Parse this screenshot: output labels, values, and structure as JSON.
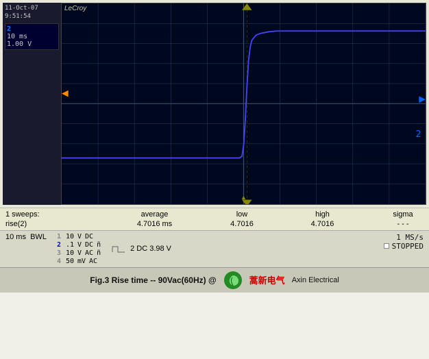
{
  "header": {
    "date": "11-Oct-07",
    "time": "9:51:54",
    "brand": "LeCroy"
  },
  "channel1": {
    "label": "2",
    "timebase": "10 ms",
    "voltage": "1.00 V"
  },
  "measurements": {
    "sweeps": "1 sweeps:",
    "cols": [
      "average",
      "low",
      "high",
      "sigma"
    ],
    "row_label": "rise(2)",
    "values": [
      "4.7016 ms",
      "4.7016",
      "4.7016",
      "- - -"
    ]
  },
  "settings": {
    "timebase": "10 ms",
    "bwl": "BWL",
    "ch1": {
      "num": "1",
      "volt": "10",
      "unit": "V",
      "coupling": "DC"
    },
    "ch2": {
      "num": "2",
      "volt": ".1",
      "unit": "V",
      "coupling": "DC",
      "extra": "ñ"
    },
    "ch3": {
      "num": "3",
      "volt": "10",
      "unit": "V",
      "coupling": "AC",
      "extra": "ñ"
    },
    "ch4": {
      "num": "4",
      "volt": "50",
      "unit": "mV",
      "coupling": "AC"
    },
    "sample_rate": "1 MS/s",
    "status": "STOPPED",
    "ch2_dc": "2 DC 3.98 V"
  },
  "footer": {
    "text": "Fig.3  Rise time  --  90Vac(60Hz) @",
    "logo_text": "蒿新电气",
    "extra": "Axin Electrical"
  }
}
